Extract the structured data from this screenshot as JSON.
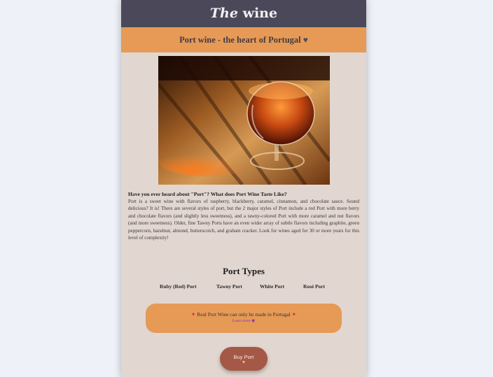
{
  "header": {
    "title_em": "The",
    "title_rest": " wine"
  },
  "subheader": {
    "text": "Port wine - the heart of Portugal",
    "heart_icon": "heart-icon"
  },
  "hero_image": {
    "icon": "wine-glass-photo"
  },
  "article": {
    "title": "Have you ever heard about \"Port\"? What does Port Wine Taste Like?",
    "body": "Port is a sweet wine with flavors of raspberry, blackberry, caramel, cinnamon, and chocolate sauce. Sound delicious? It is! There are several styles of port, but the 2 major styles of Port include a red Port with more berry and chocolate flavors (and slightly less sweetness), and a tawny-colored Port with more caramel and nut flavors (and more sweetness). Older, fine Tawny Ports have an even wider array of subtle flavors including graphite, green peppercorn, hazelnut, almond, butterscotch, and graham cracker. Look for wines aged for 30 or more years for this level of complexity!"
  },
  "types": {
    "title": "Port Types",
    "items": [
      "Ruby (Red) Port",
      "Tawny Port",
      "White Port",
      "Rosé Port"
    ]
  },
  "banner": {
    "text": "Real Port Wine can only be made in Portugal",
    "pin_icon": "pushpin-icon",
    "link": "Learn more",
    "link_icon": "grapes-icon"
  },
  "cta": {
    "label": "Buy Port",
    "icon": "wine-glass-icon"
  },
  "colors": {
    "topbar": "#4b4959",
    "accent": "#e69a56",
    "page": "#e2d6d0",
    "button": "#a55845"
  }
}
